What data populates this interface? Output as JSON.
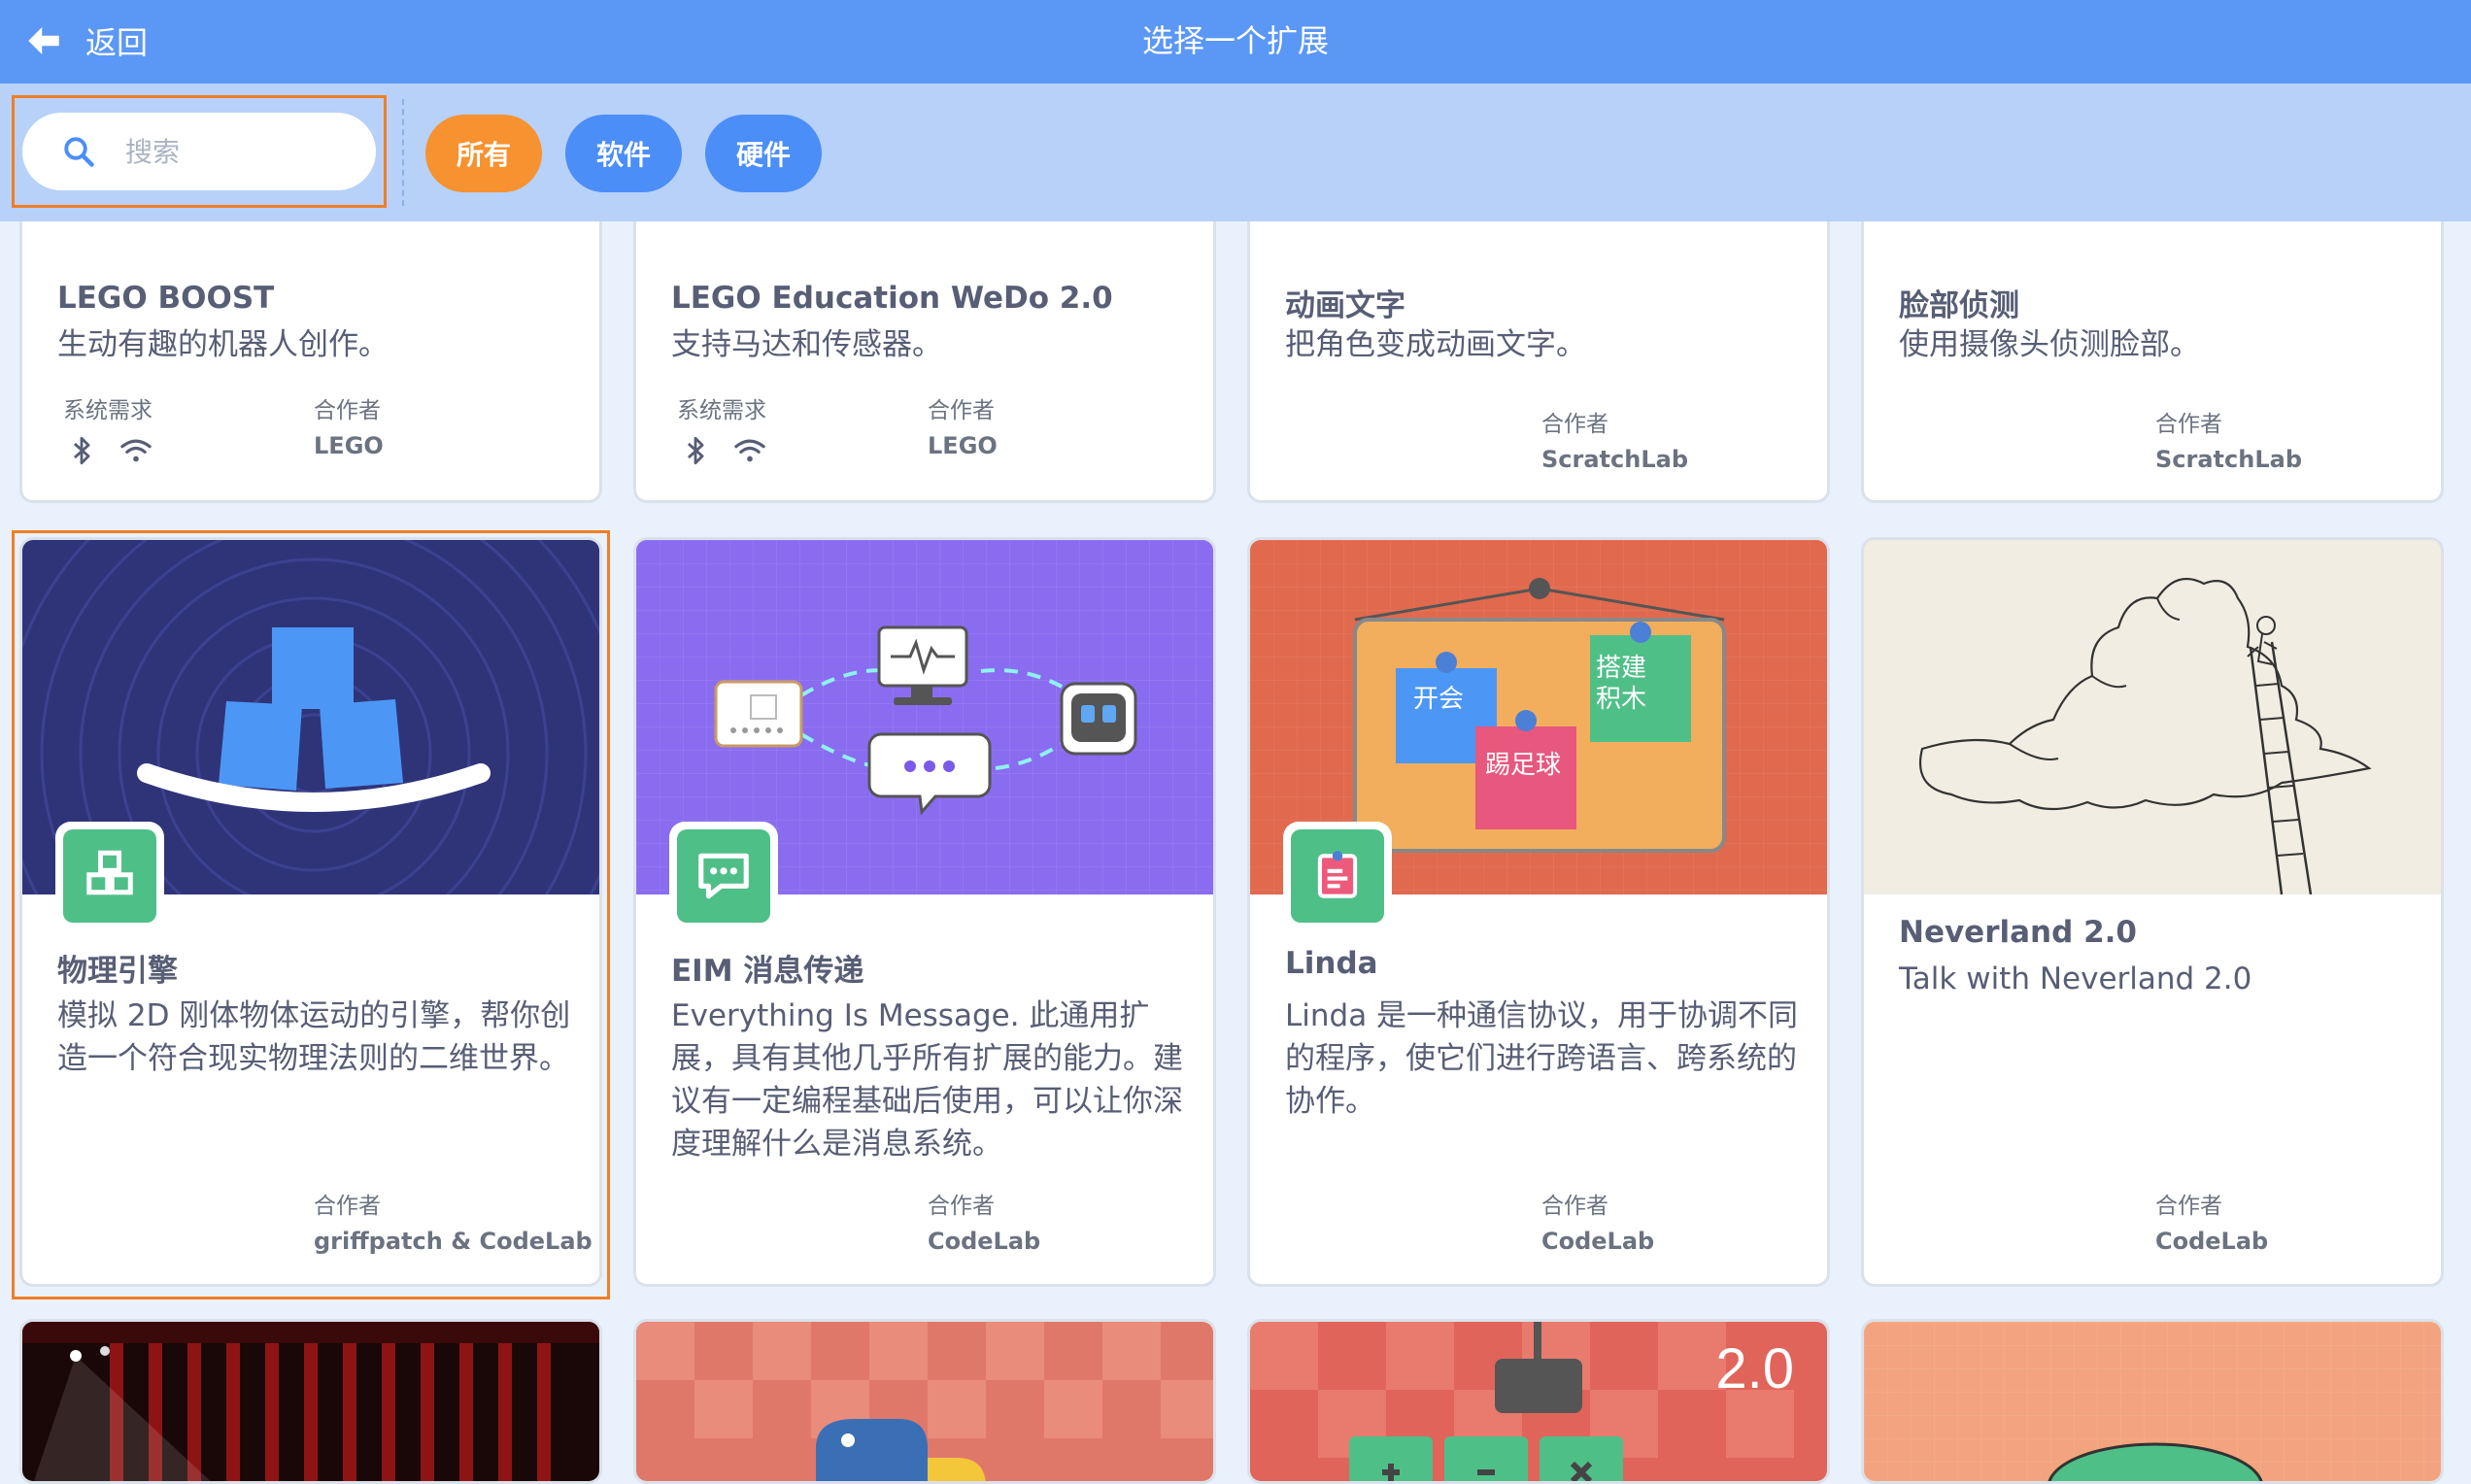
{
  "header": {
    "back_label": "返回",
    "title": "选择一个扩展"
  },
  "search": {
    "placeholder": "搜索",
    "value": ""
  },
  "filters": [
    {
      "label": "所有",
      "color": "#f6922f",
      "active": true
    },
    {
      "label": "软件",
      "color": "#4c8ef7",
      "active": false
    },
    {
      "label": "硬件",
      "color": "#4c8ef7",
      "active": false
    }
  ],
  "labels": {
    "requirements": "系统需求",
    "collaborator": "合作者"
  },
  "row1": [
    {
      "title": "LEGO BOOST",
      "description": "生动有趣的机器人创作。",
      "collaborator": "LEGO",
      "requirements": [
        "bluetooth-icon",
        "wifi-icon"
      ],
      "stripe": "#f6b83a"
    },
    {
      "title": "LEGO Education WeDo 2.0",
      "description": "支持马达和传感器。",
      "collaborator": "LEGO",
      "requirements": [
        "bluetooth-icon",
        "wifi-icon"
      ],
      "stripe": "#e8577e"
    },
    {
      "title": "动画文字",
      "description": "把角色变成动画文字。",
      "collaborator": "ScratchLab",
      "requirements": [],
      "stripe": "#8f6ff0"
    },
    {
      "title": "脸部侦测",
      "description": "使用摄像头侦测脸部。",
      "collaborator": "ScratchLab",
      "requirements": [],
      "stripe": "#f6b83a"
    }
  ],
  "row2": [
    {
      "title": "物理引擎",
      "description": "模拟 2D 刚体物体运动的引擎，帮你创造一个符合现实物理法则的二维世界。",
      "collaborator": "griffpatch & CodeLab",
      "icon": "blocks-icon",
      "banner": "#2f3479"
    },
    {
      "title": "EIM 消息传递",
      "description": "Everything Is Message. 此通用扩展，具有其他几乎所有扩展的能力。建议有一定编程基础后使用，可以让你深度理解什么是消息系统。",
      "collaborator": "CodeLab",
      "icon": "chat-icon",
      "banner": "#8a6cf0"
    },
    {
      "title": "Linda",
      "description": "Linda 是一种通信协议，用于协调不同的程序，使它们进行跨语言、跨系统的协作。",
      "collaborator": "CodeLab",
      "icon": "sticky-note-icon",
      "banner": "#e0694e"
    },
    {
      "title": "Neverland 2.0",
      "description": "Talk with Neverland 2.0",
      "collaborator": "CodeLab",
      "icon": "",
      "banner": "#f1ede3"
    }
  ],
  "linda_notes": [
    "开会",
    "搭建积木",
    "踢足球"
  ],
  "row3_banner_text": "2.0",
  "colors": {
    "accent_orange": "#f07e25",
    "header_blue": "#5b97f5",
    "filter_bar": "#b7d1f9",
    "green_icon": "#4fbf88",
    "text": "#575e75"
  }
}
